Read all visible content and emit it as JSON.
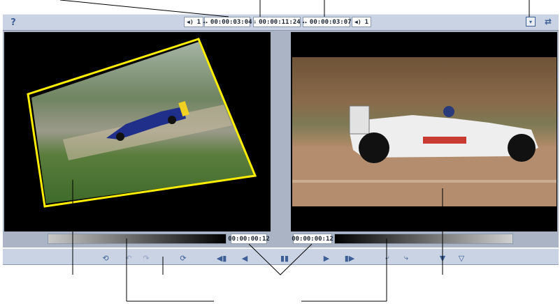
{
  "top_bar": {
    "help_label": "?",
    "left_audio_icon": "speaker-icon",
    "left_audio_channel": "1",
    "left_clip_timecode": "00:00:03:04",
    "duration_timecode": "00:00:11:24",
    "right_clip_timecode": "00:00:03:07",
    "right_audio_icon": "speaker-icon",
    "right_audio_channel": "1"
  },
  "bottom_bar": {
    "left_position_timecode": "00:00:00:12",
    "right_position_timecode": "00:00:00:12",
    "left_scrub_fill_fraction": 1.0,
    "right_scrub_fill_fraction": 0.0
  },
  "colors": {
    "toolbar_bg": "#c9d3e4",
    "panel_bg": "#aab4c4",
    "preview_bg": "#000000",
    "transform_outline": "#ffee00",
    "icon_accent": "#3d5f96"
  }
}
